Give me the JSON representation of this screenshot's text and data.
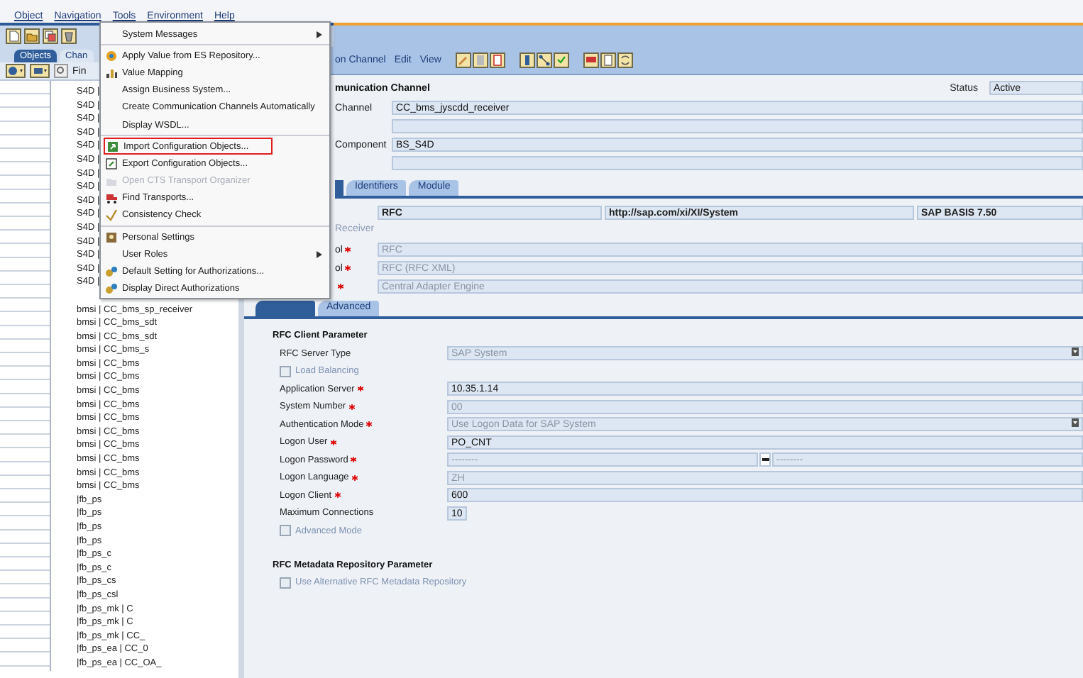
{
  "menu_bar": [
    {
      "label": "Object"
    },
    {
      "label": "Navigation"
    },
    {
      "label": "Tools"
    },
    {
      "label": "Environment"
    },
    {
      "label": "Help"
    }
  ],
  "tools_menu": [
    {
      "label": "System Messages",
      "kind": "submenu",
      "disabled": false,
      "highlighted": false,
      "separator_after": true
    },
    {
      "label": "Apply Value from ES Repository...",
      "kind": "item",
      "disabled": false,
      "highlighted": false,
      "separator_after": false
    },
    {
      "label": "Value Mapping",
      "kind": "item",
      "disabled": false,
      "highlighted": false,
      "separator_after": false
    },
    {
      "label": "Assign Business System...",
      "kind": "item",
      "disabled": false,
      "highlighted": false,
      "separator_after": false
    },
    {
      "label": "Create Communication Channels Automatically",
      "kind": "item",
      "disabled": false,
      "highlighted": false,
      "separator_after": false
    },
    {
      "label": "Display WSDL...",
      "kind": "item",
      "disabled": false,
      "highlighted": false,
      "separator_after": true
    },
    {
      "label": "Import Configuration Objects...",
      "kind": "item",
      "disabled": false,
      "highlighted": true,
      "separator_after": false
    },
    {
      "label": "Export Configuration Objects...",
      "kind": "item",
      "disabled": false,
      "highlighted": false,
      "separator_after": false
    },
    {
      "label": "Open CTS Transport Organizer",
      "kind": "item",
      "disabled": true,
      "highlighted": false,
      "separator_after": false
    },
    {
      "label": "Find Transports...",
      "kind": "item",
      "disabled": false,
      "highlighted": false,
      "separator_after": false
    },
    {
      "label": "Consistency Check",
      "kind": "item",
      "disabled": false,
      "highlighted": false,
      "separator_after": true
    },
    {
      "label": "Personal Settings",
      "kind": "item",
      "disabled": false,
      "highlighted": false,
      "separator_after": false
    },
    {
      "label": "User Roles",
      "kind": "submenu",
      "disabled": false,
      "highlighted": false,
      "separator_after": false
    },
    {
      "label": "Default Setting for Authorizations...",
      "kind": "item",
      "disabled": false,
      "highlighted": false,
      "separator_after": false
    },
    {
      "label": "Display Direct Authorizations",
      "kind": "item",
      "disabled": false,
      "highlighted": false,
      "separator_after": false
    }
  ],
  "navigator": {
    "tabs": [
      {
        "label": "Objects",
        "selected": true
      },
      {
        "label": "Chan",
        "selected": false
      }
    ],
    "find_label": "Fin",
    "tree": [
      "S4D |",
      "S4D |",
      "S4D |",
      "S4D |",
      "S4D |",
      "S4D |",
      "S4D |",
      "S4D |",
      "S4D |",
      "S4D |",
      "S4D |",
      "S4D |",
      "S4D |",
      "S4D |",
      "S4D |",
      "bmsi | CC_bms_sp_receiver",
      "bmsi | CC_bms_sdt",
      "bmsi | CC_bms_sdt",
      "bmsi | CC_bms_s",
      "bmsi | CC_bms",
      "bmsi | CC_bms",
      "bmsi | CC_bms",
      "bmsi | CC_bms",
      "bmsi | CC_bms",
      "bmsi | CC_bms",
      "bmsi | CC_bms",
      "bmsi | CC_bms",
      "bmsi | CC_bms",
      "bmsi | CC_bms",
      "|fb_ps",
      "|fb_ps",
      "|fb_ps",
      "|fb_ps",
      "|fb_ps_c",
      "|fb_ps_c",
      "|fb_ps_cs",
      "|fb_ps_csl",
      "|fb_ps_mk | C",
      "|fb_ps_mk | C",
      "|fb_ps_mk | CC_",
      "|fb_ps_ea | CC_0",
      "|fb_ps_ea | CC_OA_"
    ]
  },
  "editor": {
    "toolbar_menus": [
      "on Channel",
      "Edit",
      "View"
    ],
    "heading": "munication Channel",
    "status_label": "Status",
    "status_value": "Active",
    "header_rows": [
      {
        "kind": "field",
        "label": "Channel",
        "value": "CC_bms_jyscdd_receiver"
      },
      {
        "kind": "blank"
      },
      {
        "kind": "field",
        "label": "Component",
        "value": "BS_S4D"
      },
      {
        "kind": "blank"
      }
    ],
    "tabs": [
      {
        "label": "Identifiers",
        "selected": false
      },
      {
        "label": "Module",
        "selected": false
      }
    ],
    "adapter_fields": [
      "RFC",
      "http://sap.com/xi/XI/System",
      "SAP BASIS 7.50"
    ],
    "direction_label": "Receiver",
    "adapter_rows": [
      {
        "label": "ol",
        "required": true,
        "value": "RFC"
      },
      {
        "label": "ol",
        "required": true,
        "value": "RFC (RFC XML)"
      },
      {
        "required": true,
        "value": "Central Adapter Engine"
      }
    ],
    "sub_tabs": [
      {
        "label": "Advanced",
        "selected": false
      }
    ],
    "sections": [
      {
        "title": "RFC Client Parameter",
        "rows": [
          {
            "kind": "select",
            "label": "RFC Server Type",
            "required": false,
            "value": "SAP System",
            "disabled": true
          },
          {
            "kind": "checkbox",
            "label": "Load Balancing",
            "checked": false,
            "disabled": true
          },
          {
            "kind": "field",
            "label": "Application Server",
            "required": true,
            "value": "10.35.1.14",
            "disabled": false
          },
          {
            "kind": "field",
            "label": "System Number",
            "required": true,
            "value": "00",
            "disabled": true
          },
          {
            "kind": "select",
            "label": "Authentication Mode",
            "required": true,
            "value": "Use Logon Data for SAP System",
            "disabled": true
          },
          {
            "kind": "field",
            "label": "Logon User",
            "required": true,
            "value": "PO_CNT",
            "disabled": false
          },
          {
            "kind": "password",
            "label": "Logon Password",
            "required": true,
            "value": "--------",
            "confirm": "--------",
            "disabled": true
          },
          {
            "kind": "field",
            "label": "Logon Language",
            "required": true,
            "value": "ZH",
            "disabled": true
          },
          {
            "kind": "field",
            "label": "Logon Client",
            "required": true,
            "value": "600",
            "disabled": false
          },
          {
            "kind": "short",
            "label": "Maximum Connections",
            "required": false,
            "value": "10",
            "disabled": false
          },
          {
            "kind": "checkbox",
            "label": "Advanced Mode",
            "checked": false,
            "disabled": true
          }
        ]
      },
      {
        "title": "RFC Metadata Repository Parameter",
        "rows": [
          {
            "kind": "checkbox",
            "label": "Use Alternative RFC Metadata Repository",
            "checked": false,
            "disabled": true
          }
        ]
      }
    ]
  }
}
